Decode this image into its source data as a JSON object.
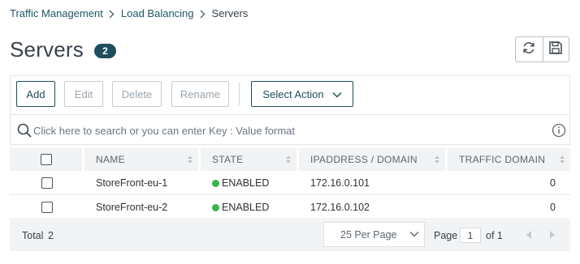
{
  "breadcrumb": {
    "items": [
      "Traffic Management",
      "Load Balancing",
      "Servers"
    ]
  },
  "page": {
    "title": "Servers",
    "count": "2"
  },
  "header_actions": {
    "refresh_icon": "refresh-icon",
    "save_icon": "save-icon"
  },
  "toolbar": {
    "add_label": "Add",
    "edit_label": "Edit",
    "delete_label": "Delete",
    "rename_label": "Rename",
    "select_action_label": "Select Action"
  },
  "search": {
    "placeholder": "Click here to search or you can enter Key : Value format",
    "value": ""
  },
  "table": {
    "columns": [
      "NAME",
      "STATE",
      "IPADDRESS / DOMAIN",
      "TRAFFIC DOMAIN"
    ],
    "rows": [
      {
        "name": "StoreFront-eu-1",
        "state": "ENABLED",
        "ip": "172.16.0.101",
        "traffic_domain": "0"
      },
      {
        "name": "StoreFront-eu-2",
        "state": "ENABLED",
        "ip": "172.16.0.102",
        "traffic_domain": "0"
      }
    ]
  },
  "footer": {
    "total_label": "Total",
    "total_value": "2",
    "per_page": "25 Per Page",
    "page_label": "Page",
    "page_value": "1",
    "page_of": "of 1"
  },
  "colors": {
    "accent": "#1e4e5b",
    "enabled_status": "#3ab449",
    "header_bg": "#f1f3f4"
  }
}
